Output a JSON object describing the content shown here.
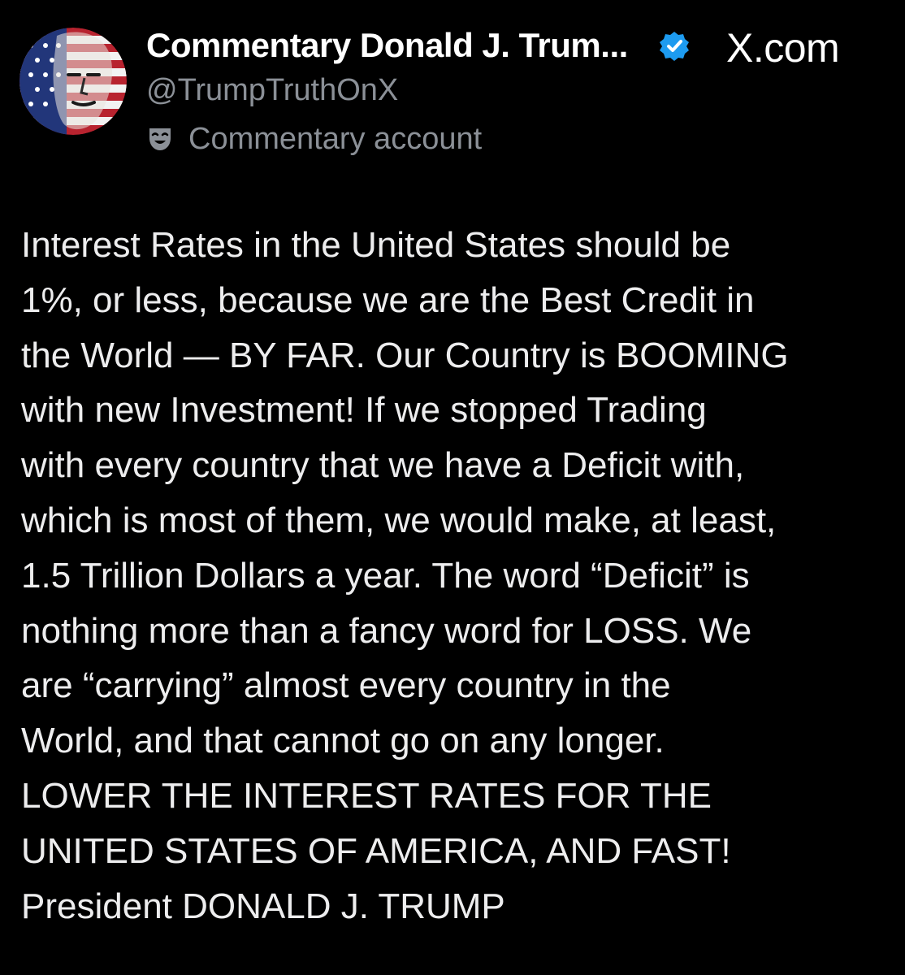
{
  "post": {
    "author": {
      "display_name": "Commentary Donald J. Trum...",
      "handle": "@TrumpTruthOnX",
      "verified": true,
      "avatar_icon": "flag-portrait-avatar",
      "account_label": "Commentary account",
      "account_label_icon": "mask-icon"
    },
    "source": "X.com",
    "body_lines": [
      "Interest Rates in the United States should be",
      "1%, or less, because we are the Best Credit in",
      "the World — BY FAR. Our Country is BOOMING",
      "with new Investment! If we stopped Trading",
      "with every country that we have a Deficit with,",
      "which is most of them, we would make, at least,",
      "1.5 Trillion Dollars a year. The word “Deficit” is",
      "nothing more than a fancy word for LOSS. We",
      "are “carrying” almost every country in the",
      "World, and that cannot go on any longer.",
      "LOWER THE INTEREST RATES FOR THE",
      "UNITED STATES OF AMERICA, AND FAST!",
      "President DONALD J. TRUMP"
    ]
  },
  "colors": {
    "background": "#000000",
    "text_primary": "#ffffff",
    "text_secondary": "#8b9097",
    "verified_badge": "#1d9bf0"
  }
}
